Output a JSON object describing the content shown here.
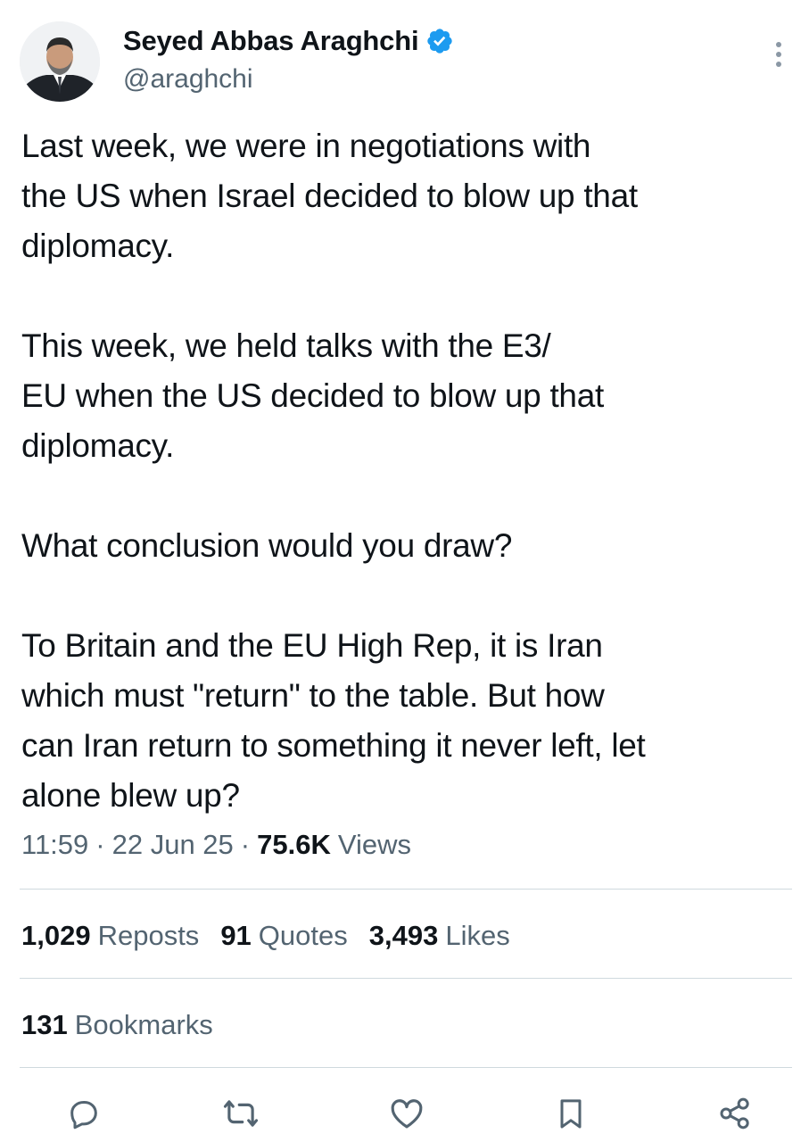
{
  "author": {
    "display_name": "Seyed Abbas Araghchi",
    "handle": "@araghchi",
    "verified": true,
    "verified_color": "#1d9bf0",
    "avatar_icon": "profile-photo"
  },
  "tweet": {
    "paragraphs": [
      "Last week, we were in negotiations with\nthe US when Israel decided to blow up that\ndiplomacy.",
      "This week, we held talks with the E3/\nEU when the US decided to blow up that\ndiplomacy.",
      "What conclusion would you draw?",
      "To Britain and the EU High Rep, it is Iran\nwhich must \"return\" to the table. But how\ncan Iran return to something it never left, let\nalone blew up?"
    ]
  },
  "meta": {
    "time": "11:59",
    "date": "22 Jun 25",
    "separator": "·",
    "views_count": "75.6K",
    "views_label": "Views"
  },
  "stats": {
    "reposts": {
      "count": "1,029",
      "label": "Reposts"
    },
    "quotes": {
      "count": "91",
      "label": "Quotes"
    },
    "likes": {
      "count": "3,493",
      "label": "Likes"
    },
    "bookmarks": {
      "count": "131",
      "label": "Bookmarks"
    }
  },
  "actions": [
    "reply-icon",
    "repost-icon",
    "like-icon",
    "bookmark-icon",
    "share-icon"
  ],
  "colors": {
    "text": "#0f1419",
    "secondary": "#536471",
    "divider": "#cfd9de",
    "verified": "#1d9bf0"
  }
}
